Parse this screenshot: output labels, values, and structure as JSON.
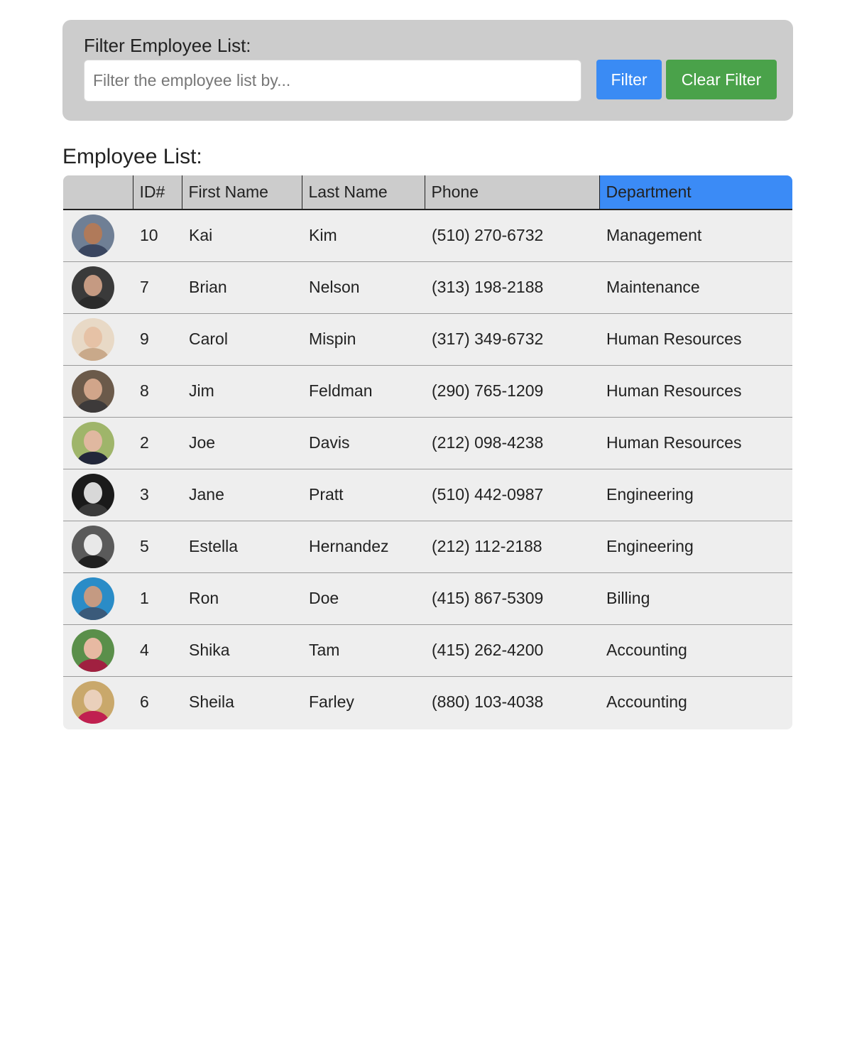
{
  "filter": {
    "title": "Filter Employee List:",
    "input_value": "",
    "placeholder": "Filter the employee list by...",
    "filter_label": "Filter",
    "clear_label": "Clear Filter"
  },
  "list_title": "Employee List:",
  "table": {
    "headers": [
      "",
      "ID#",
      "First Name",
      "Last Name",
      "Phone",
      "Department"
    ],
    "sorted_column": "Department",
    "rows": [
      {
        "id": "10",
        "first": "Kai",
        "last": "Kim",
        "phone": "(510) 270-6732",
        "department": "Management"
      },
      {
        "id": "7",
        "first": "Brian",
        "last": "Nelson",
        "phone": "(313) 198-2188",
        "department": "Maintenance"
      },
      {
        "id": "9",
        "first": "Carol",
        "last": "Mispin",
        "phone": "(317) 349-6732",
        "department": "Human Resources"
      },
      {
        "id": "8",
        "first": "Jim",
        "last": "Feldman",
        "phone": "(290) 765-1209",
        "department": "Human Resources"
      },
      {
        "id": "2",
        "first": "Joe",
        "last": "Davis",
        "phone": "(212) 098-4238",
        "department": "Human Resources"
      },
      {
        "id": "3",
        "first": "Jane",
        "last": "Pratt",
        "phone": "(510) 442-0987",
        "department": "Engineering"
      },
      {
        "id": "5",
        "first": "Estella",
        "last": "Hernandez",
        "phone": "(212) 112-2188",
        "department": "Engineering"
      },
      {
        "id": "1",
        "first": "Ron",
        "last": "Doe",
        "phone": "(415) 867-5309",
        "department": "Billing"
      },
      {
        "id": "4",
        "first": "Shika",
        "last": "Tam",
        "phone": "(415) 262-4200",
        "department": "Accounting"
      },
      {
        "id": "6",
        "first": "Sheila",
        "last": "Farley",
        "phone": "(880) 103-4038",
        "department": "Accounting"
      }
    ]
  },
  "avatars": [
    {
      "bg": "#6f7f95",
      "face": "#b07a5a",
      "body": "#3a4660"
    },
    {
      "bg": "#3a3a3a",
      "face": "#c59a82",
      "body": "#2b2b2b"
    },
    {
      "bg": "#e8d9c6",
      "face": "#e6c2a6",
      "body": "#c9a98a"
    },
    {
      "bg": "#6b5a4a",
      "face": "#d1a58a",
      "body": "#3d3a3a"
    },
    {
      "bg": "#9fb56a",
      "face": "#e0b8a0",
      "body": "#22273a"
    },
    {
      "bg": "#1a1a1a",
      "face": "#d8d8d8",
      "body": "#3a3a3a"
    },
    {
      "bg": "#5a5a5a",
      "face": "#e8e8e8",
      "body": "#202020"
    },
    {
      "bg": "#2a8cc7",
      "face": "#c49a82",
      "body": "#3a5a7a"
    },
    {
      "bg": "#5a8f4a",
      "face": "#e7b9a2",
      "body": "#a02040"
    },
    {
      "bg": "#c9a86b",
      "face": "#ead0bb",
      "body": "#c02050"
    }
  ],
  "colors": {
    "filter_button": "#3a8bf4",
    "clear_button": "#4aa24a",
    "sorted_header": "#3b8bf6"
  }
}
